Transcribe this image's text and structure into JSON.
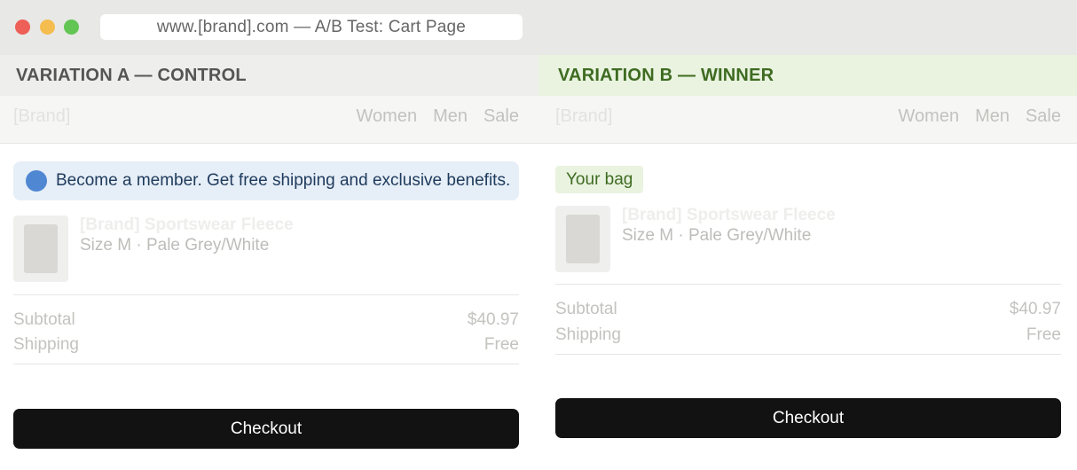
{
  "window": {
    "url": "www.[brand].com — A/B Test: Cart Page"
  },
  "nav": {
    "brand": "[Brand]",
    "links": [
      "Women",
      "Men",
      "Sale"
    ]
  },
  "variation_a": {
    "header": "VARIATION A — CONTROL",
    "banner": "Become a member. Get free shipping and exclusive benefits.",
    "item_name": "[Brand] Sportswear Fleece",
    "item_meta": "Size M · Pale Grey/White",
    "subtotal_label": "Subtotal",
    "subtotal_value": "$40.97",
    "shipping_label": "Shipping",
    "shipping_value": "Free",
    "checkout": "Checkout"
  },
  "variation_b": {
    "header": "VARIATION B — WINNER",
    "bag_label": "Your bag",
    "item_name": "[Brand] Sportswear Fleece",
    "item_meta": "Size M · Pale Grey/White",
    "subtotal_label": "Subtotal",
    "subtotal_value": "$40.97",
    "shipping_label": "Shipping",
    "shipping_value": "Free",
    "checkout": "Checkout"
  },
  "colors": {
    "winner_accent": "#3f6b21",
    "banner_dot": "#4f87d3",
    "checkout_bg": "#121212"
  }
}
